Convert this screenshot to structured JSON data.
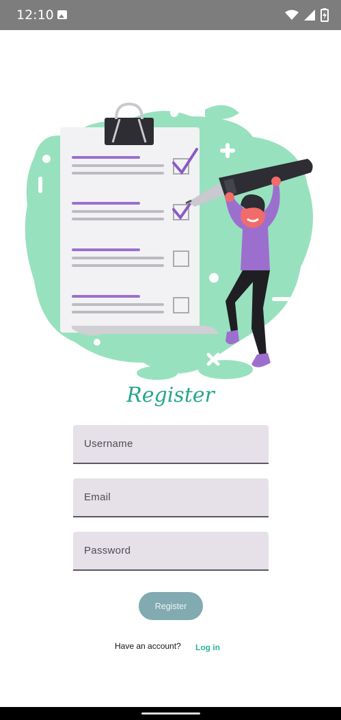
{
  "status_bar": {
    "time": "12:10",
    "icons": [
      "photo-icon",
      "wifi-icon",
      "signal-icon",
      "battery-charging-icon"
    ]
  },
  "hero": {
    "icon": "checklist-illustration",
    "colors": {
      "blob": "#98e1be",
      "accent": "#9c6fcf",
      "check": "#8a5ac6"
    }
  },
  "form": {
    "title": "Register",
    "username_placeholder": "Username",
    "email_placeholder": "Email",
    "password_placeholder": "Password",
    "submit_label": "Register"
  },
  "footer": {
    "prompt": "Have an account?",
    "login_label": "Log in"
  },
  "colors": {
    "title": "#26a68b",
    "field_bg": "#e6e1e8",
    "button_bg": "#81aab1",
    "link": "#2bb39a"
  }
}
